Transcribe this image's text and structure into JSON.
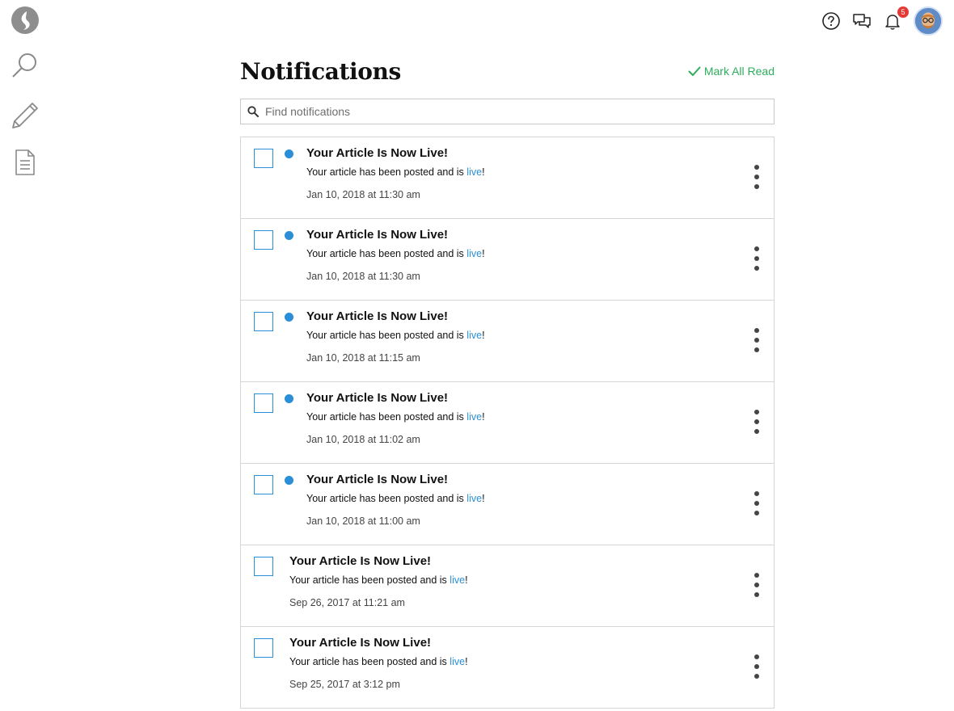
{
  "rail": {
    "icons": [
      "logo-icon",
      "search-icon",
      "pencil-icon",
      "document-icon"
    ]
  },
  "topbar": {
    "icons": [
      "help-icon",
      "chat-icon",
      "bell-icon"
    ],
    "notification_count": "5"
  },
  "page": {
    "title": "Notifications",
    "mark_all_label": "Mark All Read"
  },
  "search": {
    "placeholder": "Find notifications",
    "value": ""
  },
  "colors": {
    "accent_blue": "#2a8fd6",
    "accent_green": "#2ead5c",
    "badge_red": "#e53935"
  },
  "notifications": [
    {
      "unread": true,
      "title": "Your Article Is Now Live!",
      "body_prefix": "Your article has been posted and is ",
      "body_link": "live",
      "body_suffix": "!",
      "date": "Jan 10, 2018 at 11:30 am"
    },
    {
      "unread": true,
      "title": "Your Article Is Now Live!",
      "body_prefix": "Your article has been posted and is ",
      "body_link": "live",
      "body_suffix": "!",
      "date": "Jan 10, 2018 at 11:30 am"
    },
    {
      "unread": true,
      "title": "Your Article Is Now Live!",
      "body_prefix": "Your article has been posted and is ",
      "body_link": "live",
      "body_suffix": "!",
      "date": "Jan 10, 2018 at 11:15 am"
    },
    {
      "unread": true,
      "title": "Your Article Is Now Live!",
      "body_prefix": "Your article has been posted and is ",
      "body_link": "live",
      "body_suffix": "!",
      "date": "Jan 10, 2018 at 11:02 am"
    },
    {
      "unread": true,
      "title": "Your Article Is Now Live!",
      "body_prefix": "Your article has been posted and is ",
      "body_link": "live",
      "body_suffix": "!",
      "date": "Jan 10, 2018 at 11:00 am"
    },
    {
      "unread": false,
      "title": "Your Article Is Now Live!",
      "body_prefix": "Your article has been posted and is ",
      "body_link": "live",
      "body_suffix": "!",
      "date": "Sep 26, 2017 at 11:21 am"
    },
    {
      "unread": false,
      "title": "Your Article Is Now Live!",
      "body_prefix": "Your article has been posted and is ",
      "body_link": "live",
      "body_suffix": "!",
      "date": "Sep 25, 2017 at 3:12 pm"
    }
  ]
}
